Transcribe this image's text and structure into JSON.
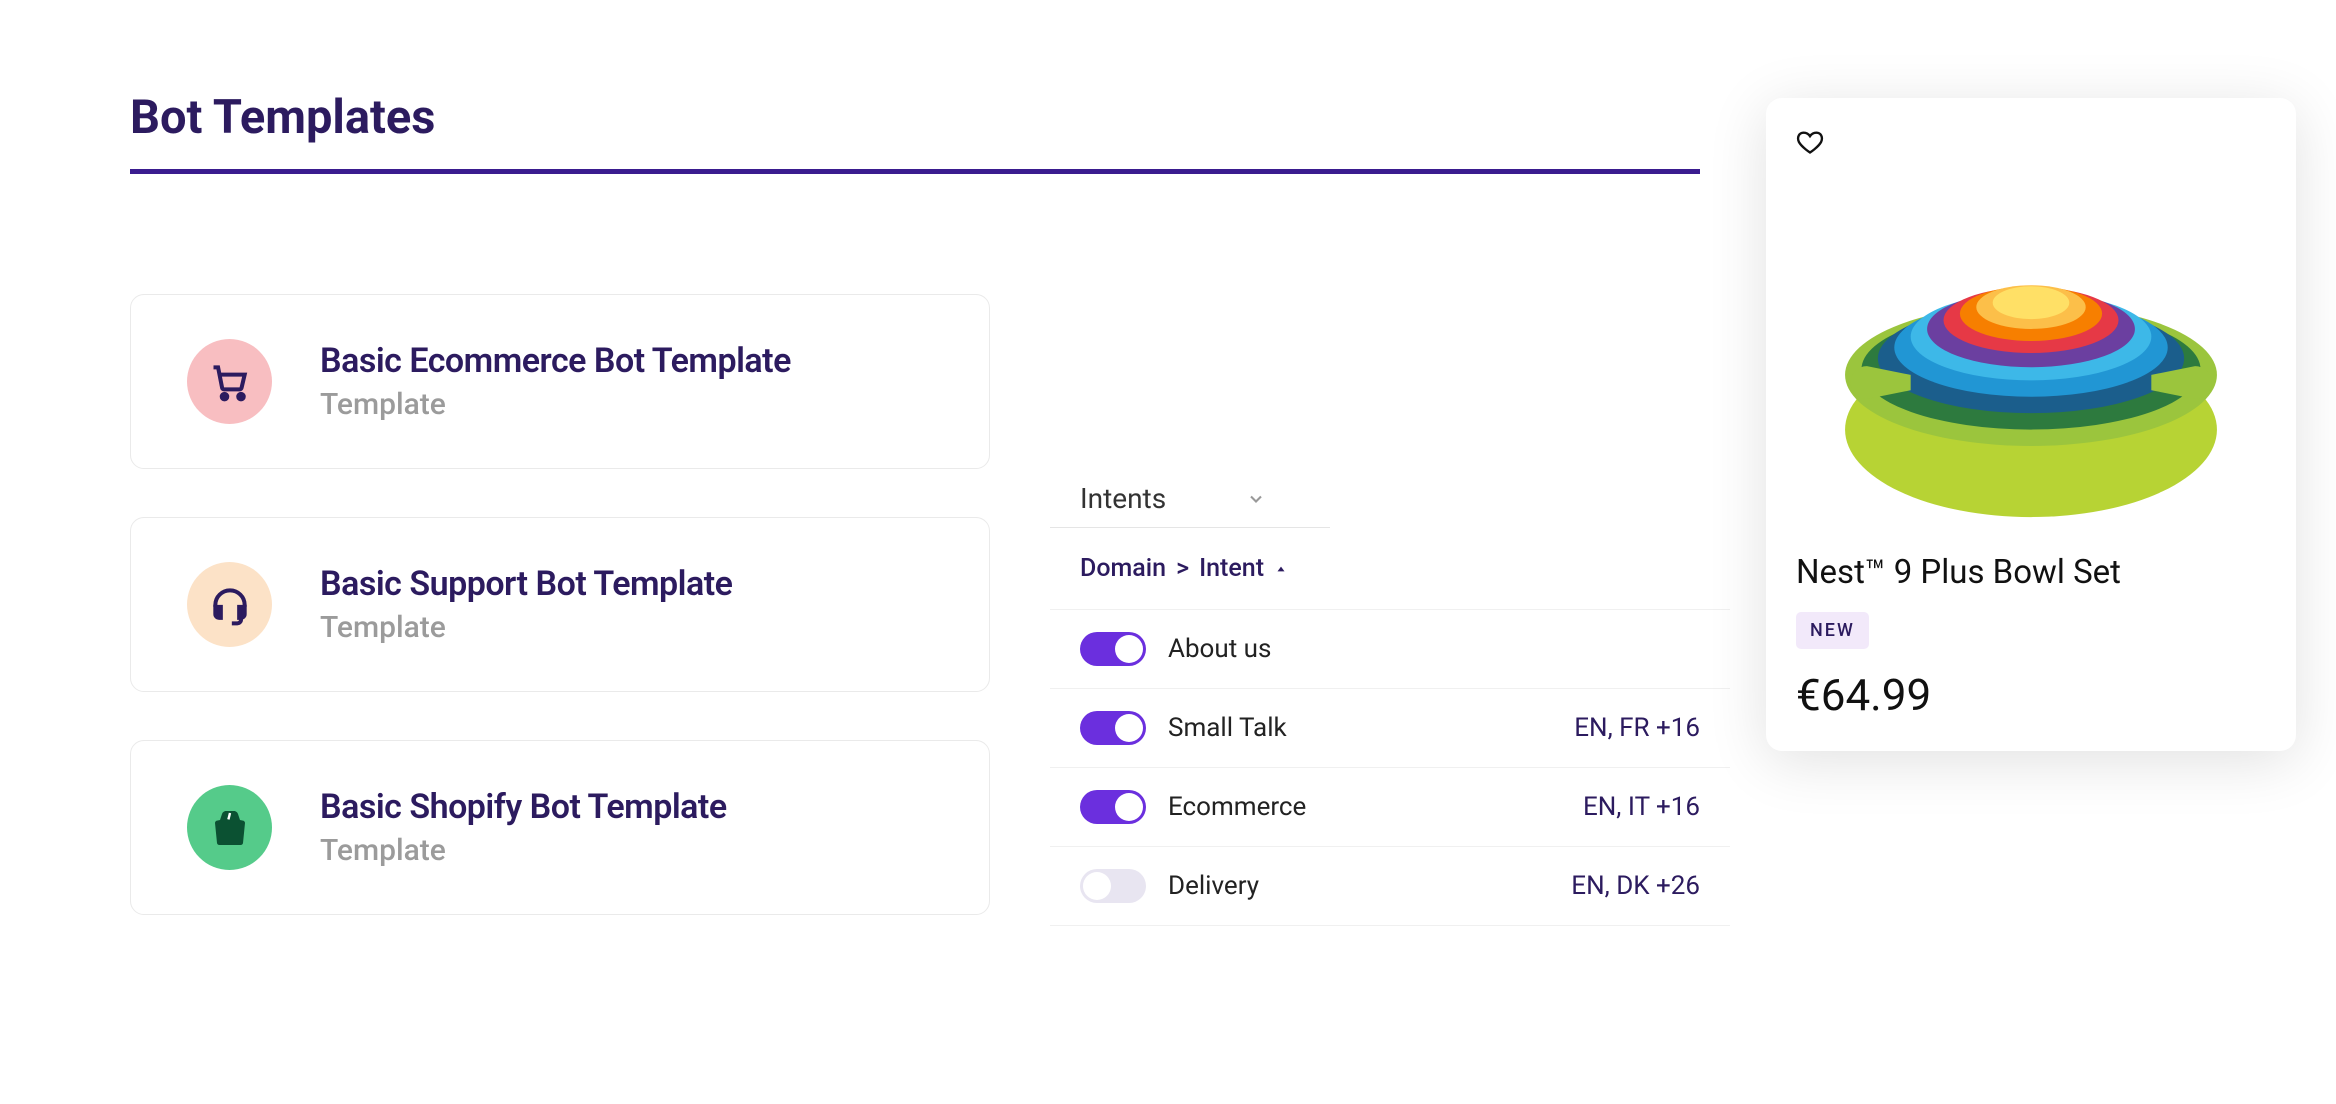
{
  "page": {
    "title": "Bot Templates"
  },
  "templates": [
    {
      "title": "Basic Ecommerce Bot Template",
      "subtitle": "Template"
    },
    {
      "title": "Basic Support Bot Template",
      "subtitle": "Template"
    },
    {
      "title": "Basic Shopify Bot Template",
      "subtitle": "Template"
    }
  ],
  "intents": {
    "heading": "Intents",
    "breadcrumb": {
      "parent": "Domain",
      "sep": ">",
      "current": "Intent"
    },
    "rows": [
      {
        "label": "About us",
        "on": true,
        "languages": ""
      },
      {
        "label": "Small Talk",
        "on": true,
        "languages": "EN, FR +16"
      },
      {
        "label": "Ecommerce",
        "on": true,
        "languages": "EN, IT +16"
      },
      {
        "label": "Delivery",
        "on": false,
        "languages": "EN, DK +26"
      }
    ]
  },
  "product": {
    "name": "Nest™ 9 Plus Bowl Set",
    "badge": "NEW",
    "price": "€64.99"
  }
}
